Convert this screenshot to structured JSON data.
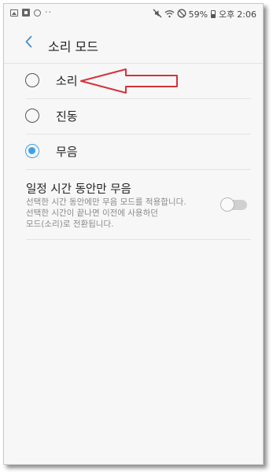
{
  "status_bar": {
    "left_icons": [
      "image-icon",
      "flag-icon",
      "sync-icon"
    ],
    "dots": "··",
    "right_icons": [
      "mute-icon",
      "wifi-icon",
      "no-disturb-icon"
    ],
    "battery_percent": "59%",
    "ampm": "오후",
    "time": "2:06"
  },
  "header": {
    "back_icon": "chevron-left-icon",
    "title": "소리 모드"
  },
  "options": [
    {
      "label": "소리",
      "selected": false
    },
    {
      "label": "진동",
      "selected": false
    },
    {
      "label": "무음",
      "selected": true
    }
  ],
  "timed_silence": {
    "title": "일정 시간 동안만 무음",
    "description_lines": [
      "선택한 시간 동안에만 무음 모드를 적용합니다.",
      "선택한 시간이 끝나면 이전에 사용하던",
      "모드(소리)로 전환됩니다."
    ],
    "toggle_on": false
  },
  "colors": {
    "accent": "#3ea0ea",
    "annotation_arrow": "#d6323a"
  }
}
